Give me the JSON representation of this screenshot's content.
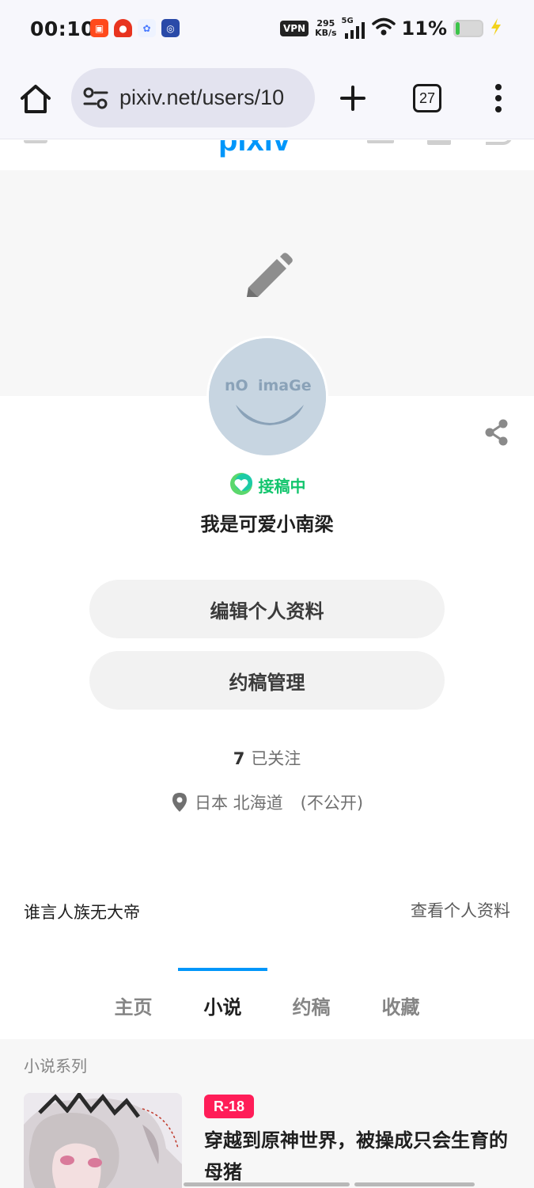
{
  "status_bar": {
    "time": "00:10",
    "vpn": "VPN",
    "net_speed_value": "295",
    "net_speed_unit": "KB/s",
    "network": "5G",
    "battery": "11%",
    "notification_icons": [
      "app-icon-orange",
      "app-icon-red",
      "app-icon-multicolor",
      "app-icon-blue"
    ]
  },
  "browser": {
    "url": "pixiv.net/users/10",
    "tab_count": "27"
  },
  "pixiv_header": {
    "logo": "pixiv"
  },
  "profile": {
    "avatar_text_left": "nO",
    "avatar_text_right": "imaGe",
    "commission_status": "接稿中",
    "name": "我是可爱小南梁",
    "edit_profile_button": "编辑个人资料",
    "commission_manage_button": "约稿管理",
    "following_count": "7",
    "following_label": "已关注",
    "location": "日本 北海道",
    "location_privacy": "(不公开)",
    "bio": "谁言人族无大帝",
    "view_profile_link": "查看个人资料"
  },
  "tabs": [
    {
      "label": "主页",
      "active": false
    },
    {
      "label": "小说",
      "active": true
    },
    {
      "label": "约稿",
      "active": false
    },
    {
      "label": "收藏",
      "active": false
    }
  ],
  "novel_series": {
    "heading": "小说系列",
    "items": [
      {
        "rating": "R-18",
        "title": "穿越到原神世界，被操成只会生育的母猪"
      }
    ]
  },
  "colors": {
    "accent": "#0096fa",
    "commission_green": "#12c56d",
    "r18_badge": "#ff1d58"
  }
}
